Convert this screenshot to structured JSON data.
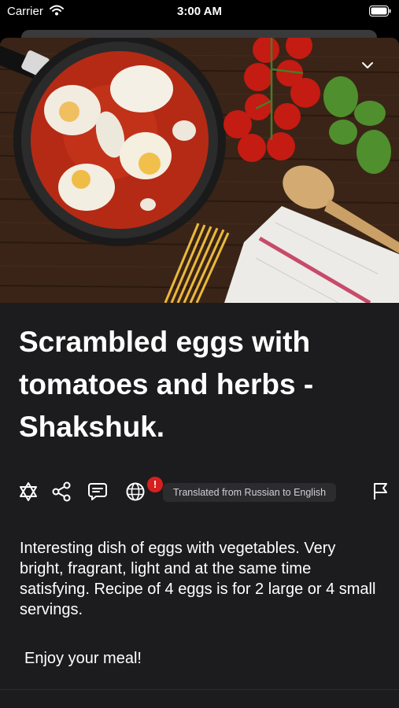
{
  "status_bar": {
    "carrier": "Carrier",
    "time": "3:00 AM"
  },
  "recipe": {
    "title": "Scrambled eggs with tomatoes and herbs - Shakshuk.",
    "translation_notice": "Translated from Russian to English",
    "warning_badge": "!",
    "description": "Interesting dish of eggs with vegetables. Very bright, fragrant, light and at the same time satisfying. Recipe of 4 eggs is for 2 large or 4 small servings.",
    "signoff": "Enjoy your meal!"
  },
  "icons": [
    "wifi-icon",
    "battery-icon",
    "collapse-chevron-icon",
    "star-of-david-icon",
    "share-icon",
    "comment-icon",
    "globe-icon",
    "flag-icon"
  ],
  "colors": {
    "background": "#000000",
    "sheet": "#1c1c1e",
    "chip": "#2c2c2e",
    "badge": "#d6201f"
  }
}
